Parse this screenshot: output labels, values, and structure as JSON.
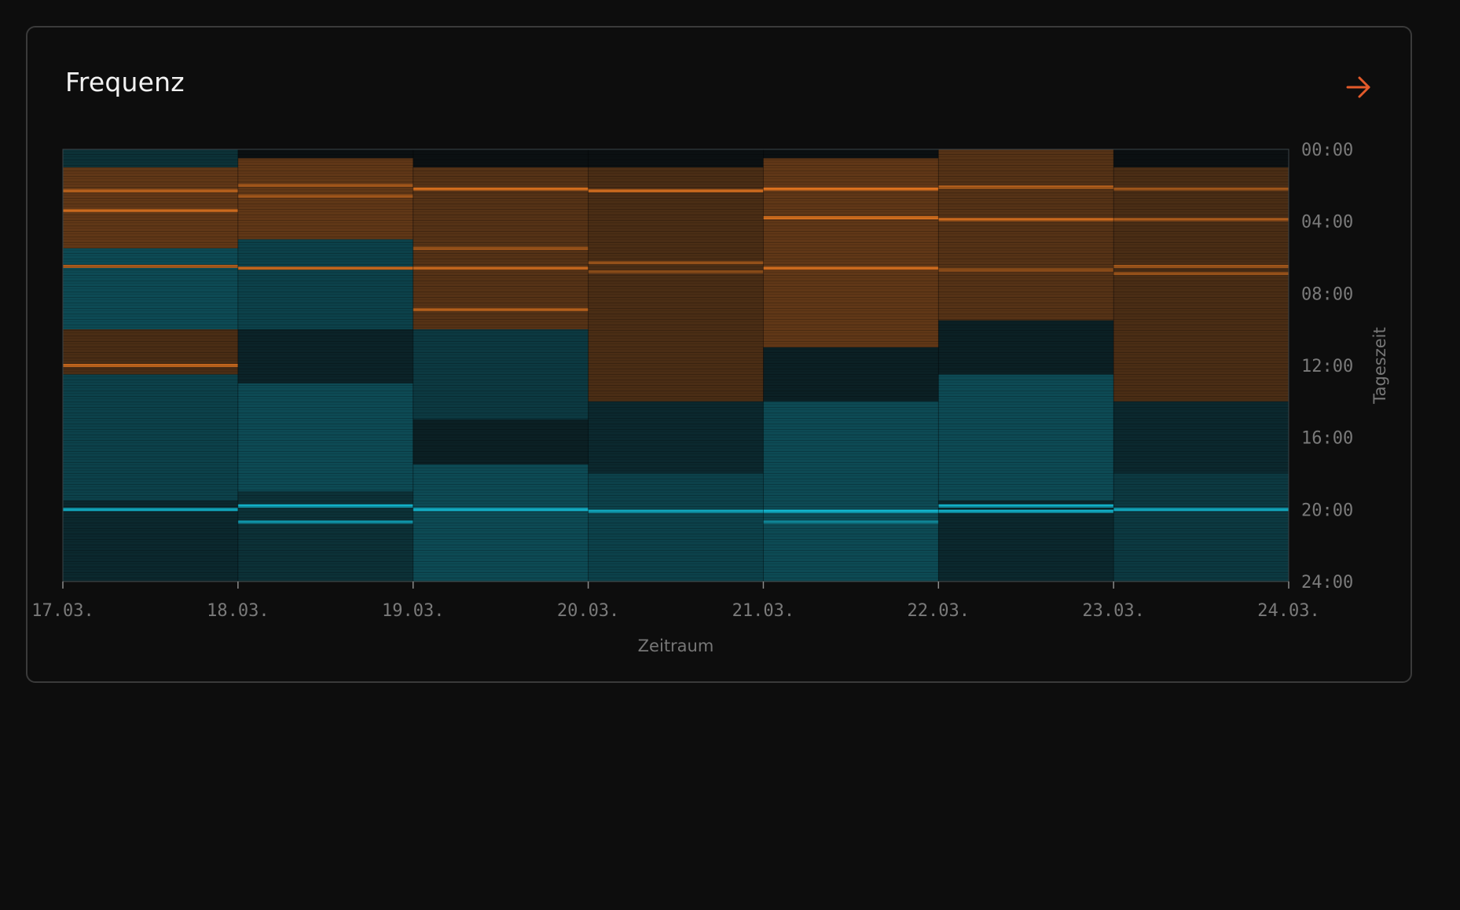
{
  "card": {
    "title": "Frequenz",
    "action_icon": "arrow-right-icon"
  },
  "colors": {
    "background": "#0d0d0d",
    "card_border": "#3a3a3a",
    "warm": "#e0741f",
    "cool": "#12b7cf",
    "accent": "#e35a2a",
    "text_muted": "#7a7a7a"
  },
  "chart_data": {
    "type": "heatmap",
    "title": "",
    "xlabel": "Zeitraum",
    "ylabel": "Tageszeit",
    "x_tick_labels": [
      "17.03.",
      "18.03.",
      "19.03.",
      "20.03.",
      "21.03.",
      "22.03.",
      "23.03.",
      "24.03."
    ],
    "y_tick_labels": [
      "00:00",
      "04:00",
      "08:00",
      "12:00",
      "16:00",
      "20:00",
      "24:00"
    ],
    "y_range_hours": [
      0,
      24
    ],
    "columns": [
      {
        "date": "17.03.",
        "bands": [
          {
            "from": 0.0,
            "to": 1.0,
            "tone": "cool",
            "level": 0.2
          },
          {
            "from": 1.0,
            "to": 5.5,
            "tone": "warm",
            "level": 0.4
          },
          {
            "from": 5.5,
            "to": 10.0,
            "tone": "cool",
            "level": 0.35
          },
          {
            "from": 10.0,
            "to": 12.5,
            "tone": "warm",
            "level": 0.3
          },
          {
            "from": 12.5,
            "to": 19.5,
            "tone": "cool",
            "level": 0.3
          },
          {
            "from": 19.5,
            "to": 24.0,
            "tone": "cool",
            "level": 0.15
          }
        ],
        "lines": [
          {
            "at": 2.3,
            "tone": "warm",
            "level": 0.8
          },
          {
            "at": 3.4,
            "tone": "warm",
            "level": 0.9
          },
          {
            "at": 6.5,
            "tone": "warm",
            "level": 0.75
          },
          {
            "at": 12.0,
            "tone": "warm",
            "level": 0.85
          },
          {
            "at": 20.0,
            "tone": "cool",
            "level": 0.9
          }
        ]
      },
      {
        "date": "18.03.",
        "bands": [
          {
            "from": 0.5,
            "to": 5.0,
            "tone": "warm",
            "level": 0.4
          },
          {
            "from": 5.0,
            "to": 10.0,
            "tone": "cool",
            "level": 0.3
          },
          {
            "from": 10.0,
            "to": 13.0,
            "tone": "cool",
            "level": 0.12
          },
          {
            "from": 13.0,
            "to": 19.0,
            "tone": "cool",
            "level": 0.35
          },
          {
            "from": 19.0,
            "to": 24.0,
            "tone": "cool",
            "level": 0.2
          }
        ],
        "lines": [
          {
            "at": 2.0,
            "tone": "warm",
            "level": 0.7
          },
          {
            "at": 2.6,
            "tone": "warm",
            "level": 0.7
          },
          {
            "at": 6.6,
            "tone": "warm",
            "level": 0.85
          },
          {
            "at": 19.8,
            "tone": "cool",
            "level": 0.95
          },
          {
            "at": 20.7,
            "tone": "cool",
            "level": 0.8
          }
        ]
      },
      {
        "date": "19.03.",
        "bands": [
          {
            "from": 1.0,
            "to": 10.0,
            "tone": "warm",
            "level": 0.35
          },
          {
            "from": 10.0,
            "to": 15.0,
            "tone": "cool",
            "level": 0.25
          },
          {
            "from": 15.0,
            "to": 17.5,
            "tone": "cool",
            "level": 0.1
          },
          {
            "from": 17.5,
            "to": 24.0,
            "tone": "cool",
            "level": 0.35
          }
        ],
        "lines": [
          {
            "at": 2.2,
            "tone": "warm",
            "level": 0.95
          },
          {
            "at": 5.5,
            "tone": "warm",
            "level": 0.7
          },
          {
            "at": 6.6,
            "tone": "warm",
            "level": 0.85
          },
          {
            "at": 8.9,
            "tone": "warm",
            "level": 0.8
          },
          {
            "at": 20.0,
            "tone": "cool",
            "level": 0.95
          }
        ]
      },
      {
        "date": "20.03.",
        "bands": [
          {
            "from": 1.0,
            "to": 14.0,
            "tone": "warm",
            "level": 0.3
          },
          {
            "from": 14.0,
            "to": 18.0,
            "tone": "cool",
            "level": 0.15
          },
          {
            "from": 18.0,
            "to": 24.0,
            "tone": "cool",
            "level": 0.3
          }
        ],
        "lines": [
          {
            "at": 2.3,
            "tone": "warm",
            "level": 0.9
          },
          {
            "at": 6.3,
            "tone": "warm",
            "level": 0.65
          },
          {
            "at": 6.8,
            "tone": "warm",
            "level": 0.6
          },
          {
            "at": 20.1,
            "tone": "cool",
            "level": 0.9
          }
        ]
      },
      {
        "date": "21.03.",
        "bands": [
          {
            "from": 0.5,
            "to": 11.0,
            "tone": "warm",
            "level": 0.4
          },
          {
            "from": 11.0,
            "to": 14.0,
            "tone": "cool",
            "level": 0.1
          },
          {
            "from": 14.0,
            "to": 24.0,
            "tone": "cool",
            "level": 0.35
          }
        ],
        "lines": [
          {
            "at": 2.2,
            "tone": "warm",
            "level": 1.0
          },
          {
            "at": 3.8,
            "tone": "warm",
            "level": 0.95
          },
          {
            "at": 6.6,
            "tone": "warm",
            "level": 0.9
          },
          {
            "at": 20.1,
            "tone": "cool",
            "level": 1.0
          },
          {
            "at": 20.7,
            "tone": "cool",
            "level": 0.7
          }
        ]
      },
      {
        "date": "22.03.",
        "bands": [
          {
            "from": 0.0,
            "to": 9.5,
            "tone": "warm",
            "level": 0.35
          },
          {
            "from": 9.5,
            "to": 12.5,
            "tone": "cool",
            "level": 0.1
          },
          {
            "from": 12.5,
            "to": 19.5,
            "tone": "cool",
            "level": 0.35
          },
          {
            "from": 19.5,
            "to": 24.0,
            "tone": "cool",
            "level": 0.15
          }
        ],
        "lines": [
          {
            "at": 2.1,
            "tone": "warm",
            "level": 0.8
          },
          {
            "at": 3.9,
            "tone": "warm",
            "level": 0.9
          },
          {
            "at": 6.7,
            "tone": "warm",
            "level": 0.65
          },
          {
            "at": 19.8,
            "tone": "cool",
            "level": 0.95
          },
          {
            "at": 20.1,
            "tone": "cool",
            "level": 0.95
          }
        ]
      },
      {
        "date": "23.03.",
        "bands": [
          {
            "from": 1.0,
            "to": 14.0,
            "tone": "warm",
            "level": 0.3
          },
          {
            "from": 14.0,
            "to": 18.0,
            "tone": "cool",
            "level": 0.15
          },
          {
            "from": 18.0,
            "to": 24.0,
            "tone": "cool",
            "level": 0.25
          }
        ],
        "lines": [
          {
            "at": 2.2,
            "tone": "warm",
            "level": 0.7
          },
          {
            "at": 3.9,
            "tone": "warm",
            "level": 0.75
          },
          {
            "at": 6.5,
            "tone": "warm",
            "level": 0.7
          },
          {
            "at": 6.9,
            "tone": "warm",
            "level": 0.65
          },
          {
            "at": 20.0,
            "tone": "cool",
            "level": 0.9
          }
        ]
      }
    ]
  }
}
